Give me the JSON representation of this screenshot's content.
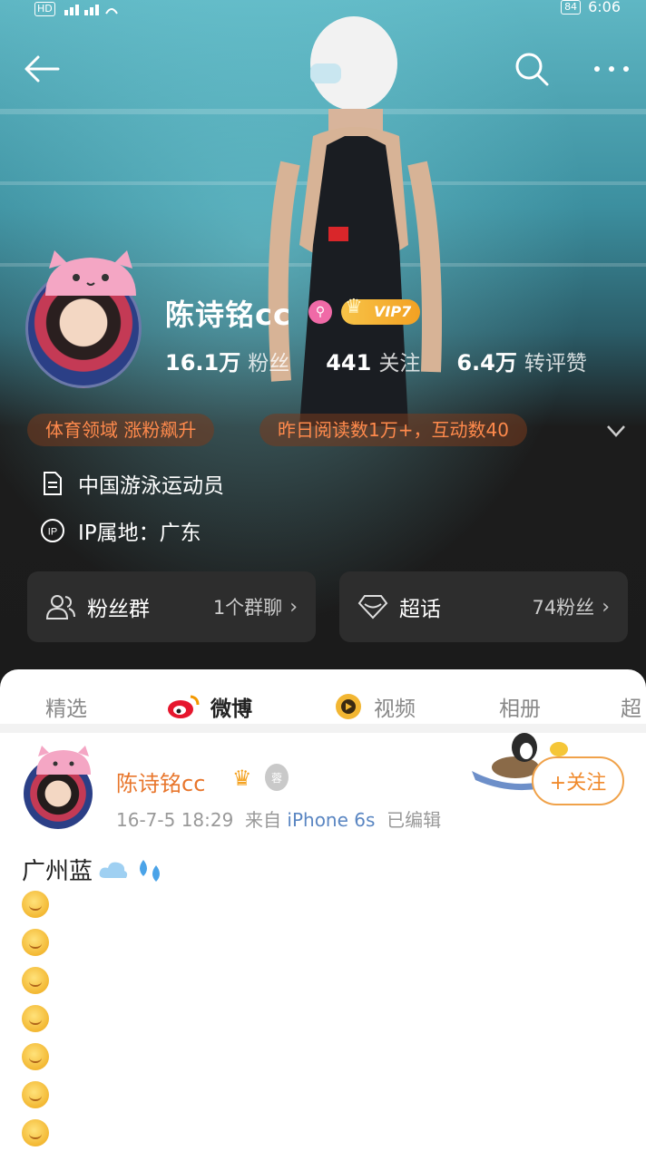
{
  "status_bar": {
    "hd": "HD",
    "time": "6:06",
    "battery": "84"
  },
  "profile": {
    "name": "陈诗铭cc",
    "vip": "VIP7",
    "stats": [
      {
        "num": "16.1万",
        "label": "粉丝"
      },
      {
        "num": "441",
        "label": "关注"
      },
      {
        "num": "6.4万",
        "label": "转评赞"
      }
    ],
    "tags": [
      "体育领域 涨粉飙升",
      "昨日阅读数1万+，互动数40"
    ],
    "bio": "中国游泳运动员",
    "ip": "IP属地：广东",
    "ip_icon_text": "IP",
    "cards": [
      {
        "title": "粉丝群",
        "sub": "1个群聊"
      },
      {
        "title": "超话",
        "sub": "74粉丝"
      }
    ]
  },
  "tabs": [
    "精选",
    "微博",
    "视频",
    "相册",
    "超"
  ],
  "post": {
    "name": "陈诗铭cc",
    "medal_text": "蓉",
    "time": "16-7-5 18:29",
    "from": "来自",
    "device": "iPhone 6s",
    "edited": "已编辑",
    "follow": "+关注",
    "text": "广州蓝",
    "emoji_count": 7
  },
  "colors": {
    "accent": "#f08a2c",
    "link": "#5a86c2",
    "tag_text": "#ff8a4c"
  },
  "icons": [
    "back-icon",
    "search-icon",
    "more-icon",
    "female-badge-icon",
    "vip-crown-icon",
    "chevron-down-icon",
    "document-icon",
    "ip-icon",
    "fan-group-icon",
    "super-topic-icon",
    "weibo-logo-icon",
    "video-icon",
    "crown-icon",
    "cloud-icon",
    "droplets-icon",
    "smile-emoji-icon"
  ]
}
